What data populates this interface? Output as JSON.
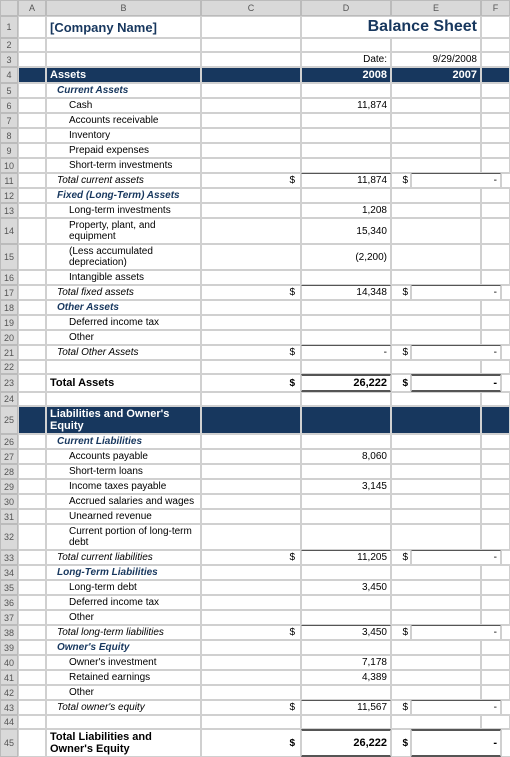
{
  "header": {
    "columns": [
      "",
      "A",
      "B",
      "C",
      "D",
      "E",
      "F"
    ],
    "company_name": "[Company Name]",
    "title": "Balance Sheet",
    "date_label": "Date:",
    "date_value": "9/29/2008"
  },
  "rows": [
    {
      "num": "1",
      "type": "company_title"
    },
    {
      "num": "2",
      "type": "blank"
    },
    {
      "num": "3",
      "type": "date_row"
    },
    {
      "num": "4",
      "type": "section_header",
      "label": "Assets",
      "col2008": "2008",
      "col2007": "2007"
    },
    {
      "num": "5",
      "type": "category_header",
      "label": "Current Assets"
    },
    {
      "num": "6",
      "type": "line_item",
      "label": "Cash",
      "col2008": "11,874",
      "col2007": ""
    },
    {
      "num": "7",
      "type": "line_item",
      "label": "Accounts receivable",
      "col2008": "",
      "col2007": ""
    },
    {
      "num": "8",
      "type": "line_item",
      "label": "Inventory",
      "col2008": "",
      "col2007": ""
    },
    {
      "num": "9",
      "type": "line_item",
      "label": "Prepaid expenses",
      "col2008": "",
      "col2007": ""
    },
    {
      "num": "10",
      "type": "line_item",
      "label": "Short-term investments",
      "col2008": "",
      "col2007": ""
    },
    {
      "num": "11",
      "type": "total_row",
      "label": "Total current assets",
      "col2008": "11,874",
      "col2007": "-"
    },
    {
      "num": "12",
      "type": "category_header",
      "label": "Fixed (Long-Term) Assets"
    },
    {
      "num": "13",
      "type": "line_item",
      "label": "Long-term investments",
      "col2008": "1,208",
      "col2007": ""
    },
    {
      "num": "14",
      "type": "line_item",
      "label": "Property, plant, and equipment",
      "col2008": "15,340",
      "col2007": ""
    },
    {
      "num": "15",
      "type": "line_item",
      "label": "(Less accumulated depreciation)",
      "col2008": "(2,200)",
      "col2007": ""
    },
    {
      "num": "16",
      "type": "line_item",
      "label": "Intangible assets",
      "col2008": "",
      "col2007": ""
    },
    {
      "num": "17",
      "type": "total_row",
      "label": "Total fixed assets",
      "col2008": "14,348",
      "col2007": "-"
    },
    {
      "num": "18",
      "type": "category_header",
      "label": "Other Assets"
    },
    {
      "num": "19",
      "type": "line_item",
      "label": "Deferred income tax",
      "col2008": "",
      "col2007": ""
    },
    {
      "num": "20",
      "type": "line_item",
      "label": "Other",
      "col2008": "",
      "col2007": ""
    },
    {
      "num": "21",
      "type": "total_row",
      "label": "Total Other Assets",
      "col2008": "-",
      "col2007": "-"
    },
    {
      "num": "22",
      "type": "blank"
    },
    {
      "num": "23",
      "type": "grand_total_row",
      "label": "Total Assets",
      "col2008": "26,222",
      "col2007": "-"
    },
    {
      "num": "24",
      "type": "blank"
    },
    {
      "num": "25",
      "type": "section_header",
      "label": "Liabilities and Owner's Equity",
      "col2008": "",
      "col2007": ""
    },
    {
      "num": "26",
      "type": "category_header",
      "label": "Current Liabilities"
    },
    {
      "num": "27",
      "type": "line_item",
      "label": "Accounts payable",
      "col2008": "8,060",
      "col2007": ""
    },
    {
      "num": "28",
      "type": "line_item",
      "label": "Short-term loans",
      "col2008": "",
      "col2007": ""
    },
    {
      "num": "29",
      "type": "line_item",
      "label": "Income taxes payable",
      "col2008": "3,145",
      "col2007": ""
    },
    {
      "num": "30",
      "type": "line_item",
      "label": "Accrued salaries and wages",
      "col2008": "",
      "col2007": ""
    },
    {
      "num": "31",
      "type": "line_item",
      "label": "Unearned revenue",
      "col2008": "",
      "col2007": ""
    },
    {
      "num": "32",
      "type": "line_item",
      "label": "Current portion of long-term debt",
      "col2008": "",
      "col2007": ""
    },
    {
      "num": "33",
      "type": "total_row",
      "label": "Total current liabilities",
      "col2008": "11,205",
      "col2007": "-"
    },
    {
      "num": "34",
      "type": "category_header",
      "label": "Long-Term Liabilities"
    },
    {
      "num": "35",
      "type": "line_item",
      "label": "Long-term debt",
      "col2008": "3,450",
      "col2007": ""
    },
    {
      "num": "36",
      "type": "line_item",
      "label": "Deferred income tax",
      "col2008": "",
      "col2007": ""
    },
    {
      "num": "37",
      "type": "line_item",
      "label": "Other",
      "col2008": "",
      "col2007": ""
    },
    {
      "num": "38",
      "type": "total_row",
      "label": "Total long-term liabilities",
      "col2008": "3,450",
      "col2007": "-"
    },
    {
      "num": "39",
      "type": "category_header",
      "label": "Owner's Equity"
    },
    {
      "num": "40",
      "type": "line_item",
      "label": "Owner's investment",
      "col2008": "7,178",
      "col2007": ""
    },
    {
      "num": "41",
      "type": "line_item",
      "label": "Retained earnings",
      "col2008": "4,389",
      "col2007": ""
    },
    {
      "num": "42",
      "type": "line_item",
      "label": "Other",
      "col2008": "",
      "col2007": ""
    },
    {
      "num": "43",
      "type": "total_row",
      "label": "Total owner's equity",
      "col2008": "11,567",
      "col2007": "-"
    },
    {
      "num": "44",
      "type": "blank"
    },
    {
      "num": "45",
      "type": "grand_total_row",
      "label": "Total Liabilities and Owner's Equity",
      "col2008": "26,222",
      "col2007": "-"
    }
  ]
}
